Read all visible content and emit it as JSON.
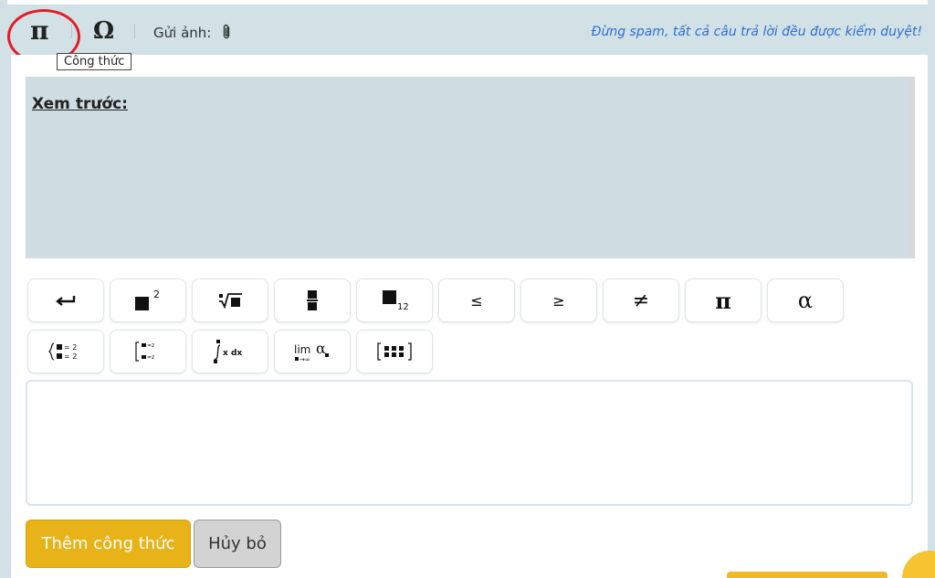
{
  "toolbar": {
    "pi_symbol": "π",
    "omega_symbol": "Ω",
    "upload_label": "Gửi ảnh:",
    "notice": "Đừng spam, tất cả câu trả lời đều được kiểm duyệt!"
  },
  "tooltip": {
    "text": "Công thức"
  },
  "preview": {
    "label": "Xem trước:"
  },
  "symbols": {
    "leq": "≤",
    "geq": "≥",
    "neq": "≠",
    "pi": "π",
    "alpha": "α",
    "lim_text": "lim",
    "lim_alpha": "α",
    "integral_text": "x dx",
    "system_eq_1": "= 2",
    "system_eq_2": "= 2",
    "subscript_12": "12",
    "superscript_2": "2"
  },
  "editor": {
    "value": ""
  },
  "actions": {
    "add_label": "Thêm công thức",
    "cancel_label": "Hủy bỏ"
  },
  "colors": {
    "accent": "#e8b319",
    "notice_blue": "#2d6fd2",
    "annotation_red": "#e21d24",
    "panel_bg": "#d2e1e6"
  }
}
